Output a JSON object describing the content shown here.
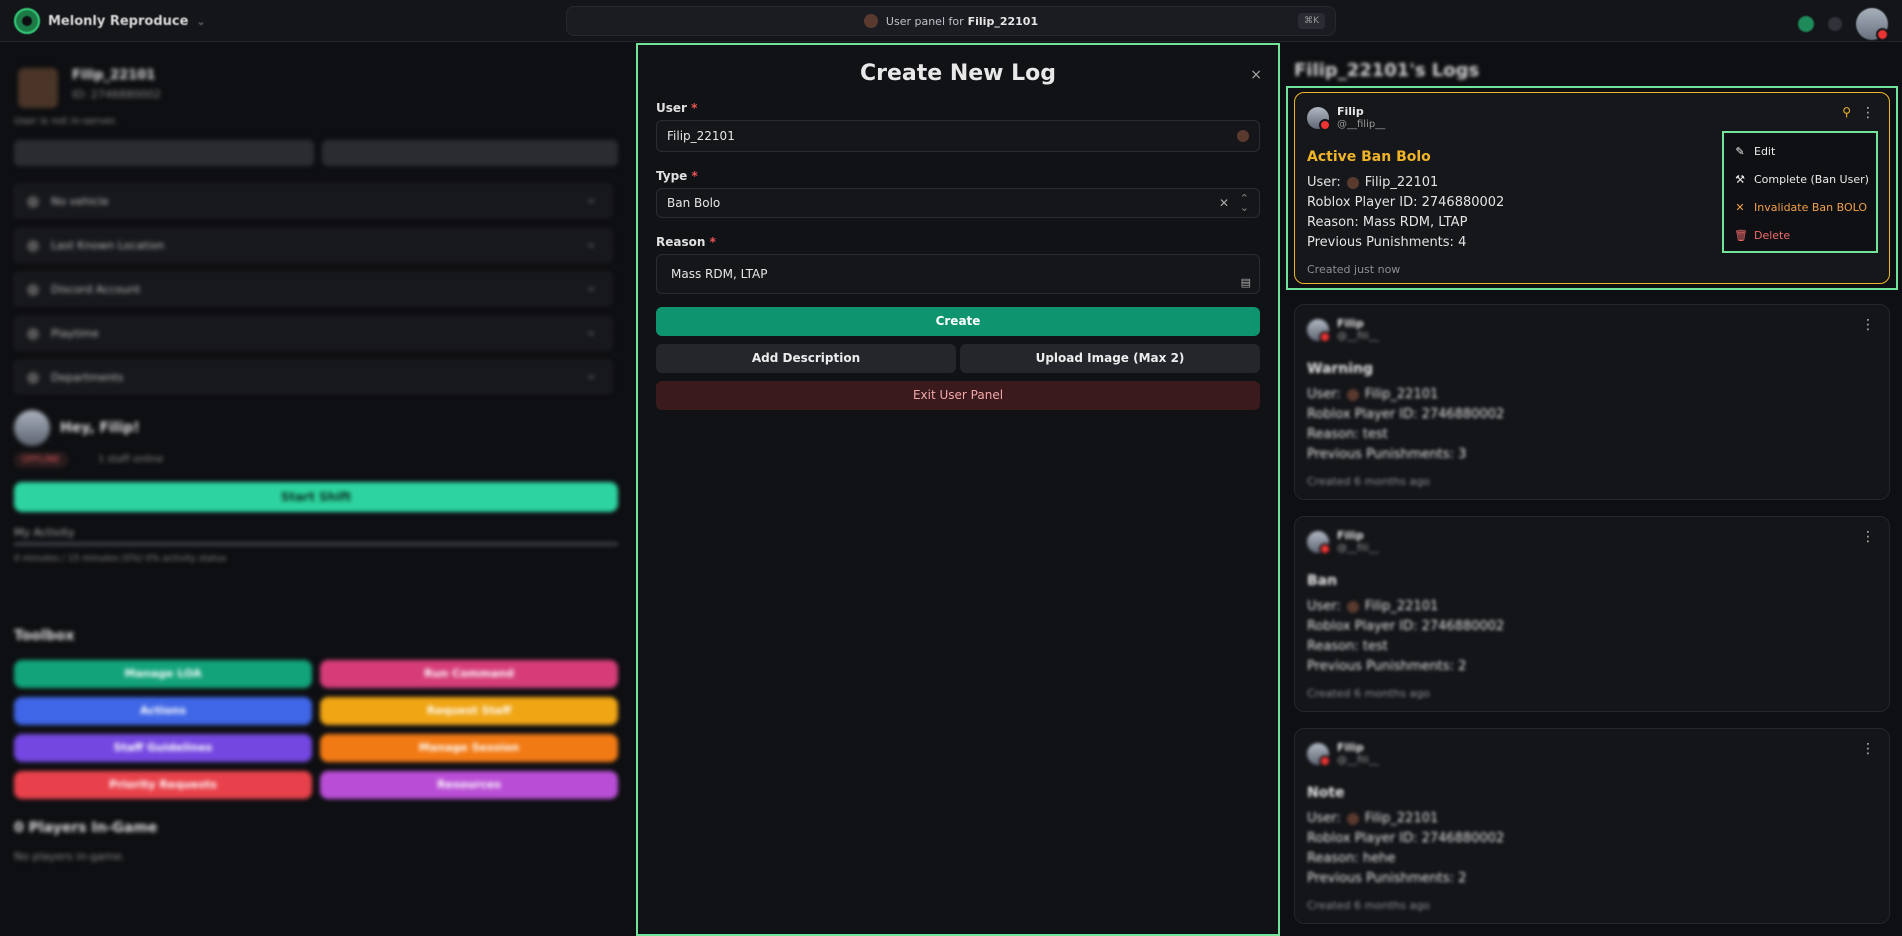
{
  "topbar": {
    "brand_name": "Melonly Reproduce",
    "search_text": "User panel for",
    "search_user": "Filip_22101",
    "search_kbd": "⌘K"
  },
  "left": {
    "profile_name": "Filip_22101",
    "profile_id": "ID: 2746880002",
    "status": "User is not in-server.",
    "accordions": [
      "No vehicle",
      "Last Known Location",
      "Discord Account",
      "Playtime",
      "Departments"
    ],
    "greeting": "Hey, Filip!",
    "offline_badge": "OFFLINE",
    "staff_online": "1 staff online",
    "start_shift": "Start Shift",
    "activity_label": "My Activity",
    "activity_text": "0 minutes / 15 minutes (0%) 0% activity status",
    "toolbox_title": "Toolbox",
    "tools": [
      {
        "label": "Manage LOA",
        "color": "#12a37a"
      },
      {
        "label": "Run Command",
        "color": "#d63d78"
      },
      {
        "label": "Actions",
        "color": "#3f66e6"
      },
      {
        "label": "Request Staff",
        "color": "#f0a514"
      },
      {
        "label": "Staff Guidelines",
        "color": "#7447e0"
      },
      {
        "label": "Manage Session",
        "color": "#f27a14"
      },
      {
        "label": "Priority Requests",
        "color": "#e8414b"
      },
      {
        "label": "Resources",
        "color": "#b94ed6"
      }
    ],
    "players_title": "0 Players In-Game",
    "no_players": "No players in-game."
  },
  "modal": {
    "title": "Create New Log",
    "close": "×",
    "user_label": "User",
    "user_value": "Filip_22101",
    "type_label": "Type",
    "type_value": "Ban Bolo",
    "reason_label": "Reason",
    "reason_value": "Mass RDM, LTAP",
    "required_mark": "*",
    "create": "Create",
    "add_description": "Add Description",
    "upload_image": "Upload Image (Max 2)",
    "exit": "Exit User Panel"
  },
  "logs": {
    "title": "Filip_22101's Logs",
    "items": [
      {
        "author": "Filip",
        "handle": "@__filip__",
        "title": "Active Ban Bolo",
        "title_color": "#f0b429",
        "user": "Filip_22101",
        "roblox_id": "2746880002",
        "reason": "Mass RDM, LTAP",
        "punishments": "4",
        "created": "Created just now"
      },
      {
        "author": "Filip",
        "handle": "@__fili__",
        "title": "Warning",
        "title_color": "#e6e6e6",
        "user": "Filip_22101",
        "roblox_id": "2746880002",
        "reason": "test",
        "punishments": "3",
        "created": "Created 6 months ago"
      },
      {
        "author": "Filip",
        "handle": "@__fili__",
        "title": "Ban",
        "title_color": "#e6e6e6",
        "user": "Filip_22101",
        "roblox_id": "2746880002",
        "reason": "test",
        "punishments": "2",
        "created": "Created 6 months ago"
      },
      {
        "author": "Filip",
        "handle": "@__fili__",
        "title": "Note",
        "title_color": "#e6e6e6",
        "user": "Filip_22101",
        "roblox_id": "2746880002",
        "reason": "hehe",
        "punishments": "2",
        "created": "Created 6 months ago"
      }
    ],
    "labels": {
      "user": "User:",
      "roblox": "Roblox Player ID:",
      "reason": "Reason:",
      "punishments": "Previous Punishments:"
    }
  },
  "context_menu": {
    "items": [
      {
        "label": "Edit",
        "icon": "pencil-icon",
        "color": "#ececec"
      },
      {
        "label": "Complete (Ban User)",
        "icon": "gavel-icon",
        "color": "#ececec"
      },
      {
        "label": "Invalidate Ban BOLO",
        "icon": "x-icon",
        "color": "#f0a04b"
      },
      {
        "label": "Delete",
        "icon": "trash-icon",
        "color": "#f06a6a"
      }
    ]
  }
}
